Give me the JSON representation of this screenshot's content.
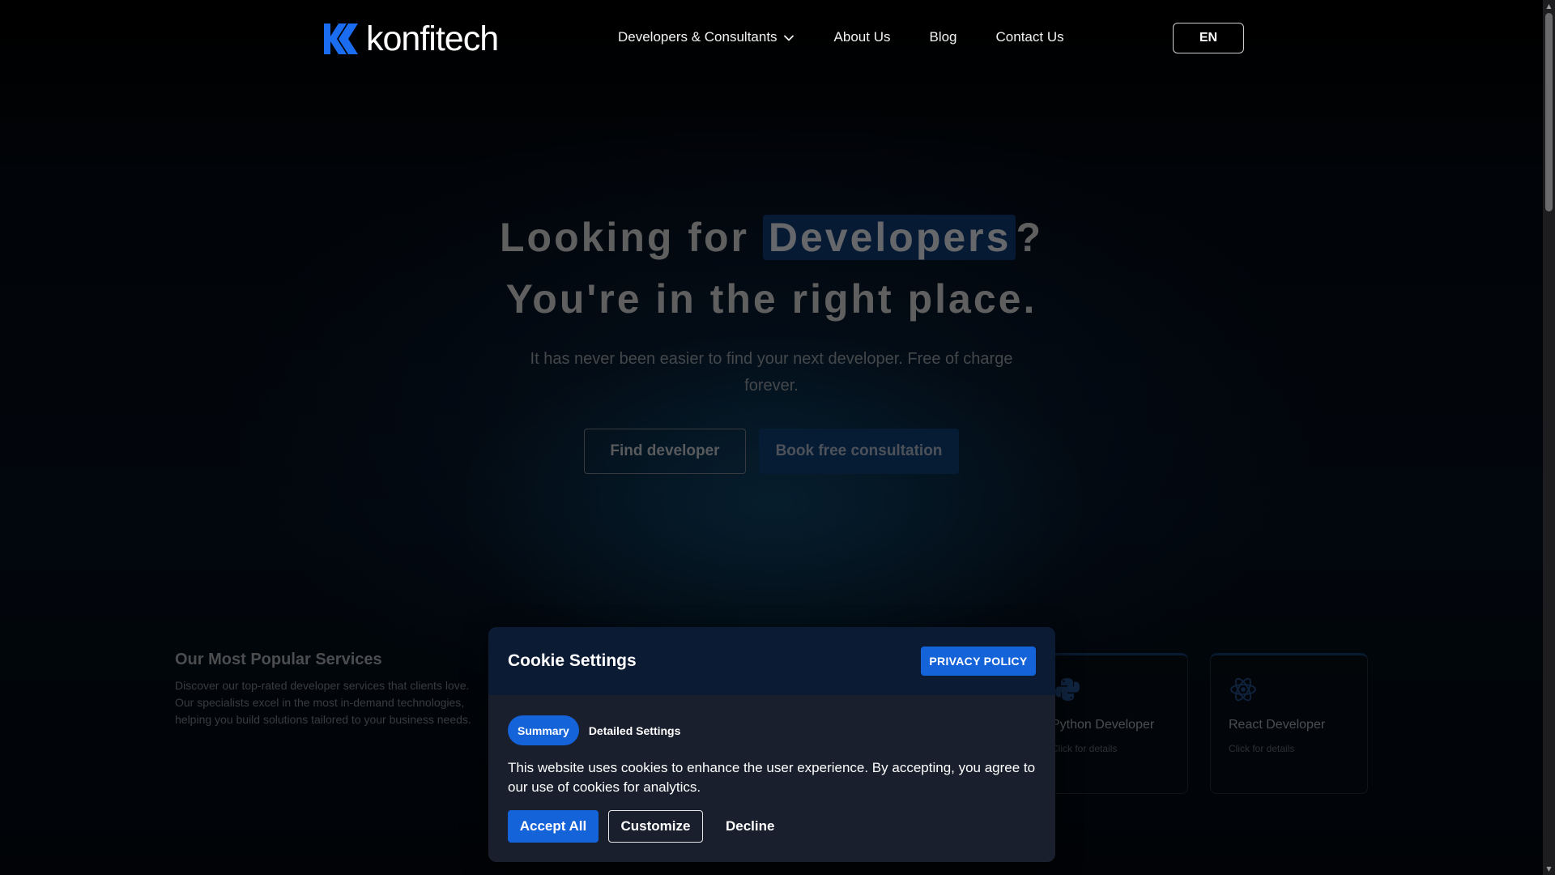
{
  "brand": {
    "name": "konfitech",
    "accent_color": "#1463d9"
  },
  "nav": {
    "items": [
      {
        "label": "Developers & Consultants",
        "has_dropdown": true
      },
      {
        "label": "About Us"
      },
      {
        "label": "Blog"
      },
      {
        "label": "Contact Us"
      }
    ],
    "language": "EN"
  },
  "hero": {
    "title_prefix": "Looking for",
    "title_highlight": "Developers",
    "title_suffix": "?",
    "title_line2": "You're in the right place.",
    "subtitle": "It has never been easier to find your next developer. Free of charge forever.",
    "cta_primary": "Find developer",
    "cta_secondary": "Book free consultation"
  },
  "services": {
    "title": "Our Most Popular Services",
    "description": "Discover our top-rated developer services that clients love. Our specialists excel in the most in-demand technologies, helping you build solutions tailored to your business needs.",
    "cards": [
      {
        "name": "Python Developer",
        "hint": "Click for details",
        "icon": "python-icon"
      },
      {
        "name": "React Developer",
        "hint": "Click for details",
        "icon": "react-icon"
      }
    ]
  },
  "cookie": {
    "title": "Cookie Settings",
    "privacy_label": "PRIVACY POLICY",
    "tabs": [
      "Summary",
      "Detailed Settings"
    ],
    "active_tab": "Summary",
    "text": "This website uses cookies to enhance the user experience. By accepting, you agree to our use of cookies for analytics.",
    "accept_label": "Accept All",
    "customize_label": "Customize",
    "decline_label": "Decline"
  }
}
